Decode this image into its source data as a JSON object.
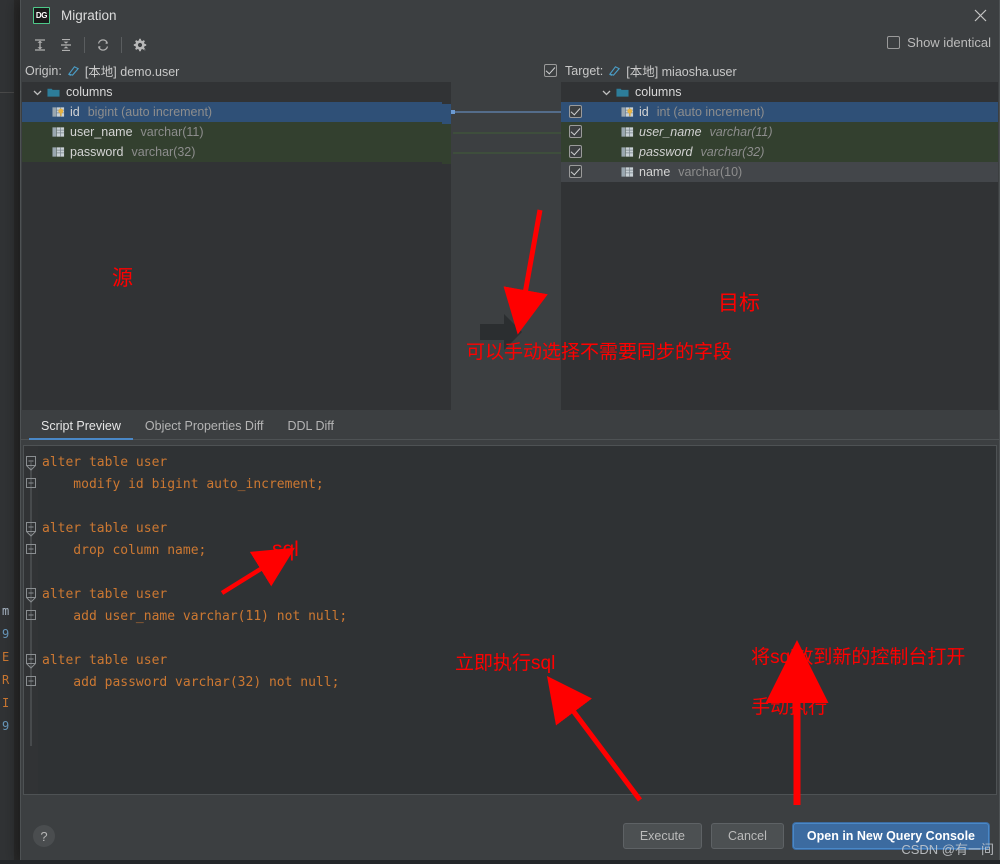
{
  "window": {
    "title": "Migration",
    "logo_text": "DG",
    "close_icon": "close-icon"
  },
  "toolbar": {
    "buttons": [
      {
        "name": "expand-all-icon",
        "tooltip": "Expand All"
      },
      {
        "name": "collapse-all-icon",
        "tooltip": "Collapse All"
      },
      {
        "name": "refresh-icon",
        "tooltip": "Refresh"
      },
      {
        "name": "settings-gear-icon",
        "tooltip": "Settings"
      }
    ],
    "show_identical_label": "Show identical",
    "show_identical_checked": false
  },
  "origin": {
    "label": "Origin:",
    "value": "[本地] demo.user",
    "checkbox_visible": false
  },
  "target": {
    "label": "Target:",
    "value": "[本地] miaosha.user",
    "checkbox_checked": true
  },
  "left_pane": {
    "root": {
      "label": "columns",
      "expanded": true
    },
    "rows": [
      {
        "name": "id",
        "type": "bigint (auto increment)",
        "state": "selected",
        "icon": "primary-key-column-icon",
        "italic": false
      },
      {
        "name": "user_name",
        "type": "varchar(11)",
        "state": "changed",
        "icon": "column-icon",
        "italic": false
      },
      {
        "name": "password",
        "type": "varchar(32)",
        "state": "changed",
        "icon": "column-icon",
        "italic": false
      }
    ]
  },
  "right_pane": {
    "root": {
      "label": "columns",
      "expanded": true
    },
    "rows": [
      {
        "name": "id",
        "type": "int (auto increment)",
        "state": "selected",
        "icon": "primary-key-column-icon",
        "italic": false,
        "checked": true
      },
      {
        "name": "user_name",
        "type": "varchar(11)",
        "state": "changed",
        "icon": "column-icon",
        "italic": true,
        "checked": true
      },
      {
        "name": "password",
        "type": "varchar(32)",
        "state": "changed",
        "icon": "column-icon",
        "italic": true,
        "checked": true
      },
      {
        "name": "name",
        "type": "varchar(10)",
        "state": "removed",
        "icon": "column-icon",
        "italic": false,
        "checked": true
      }
    ]
  },
  "tabs": [
    {
      "label": "Script Preview",
      "active": true
    },
    {
      "label": "Object Properties Diff",
      "active": false
    },
    {
      "label": "DDL Diff",
      "active": false
    }
  ],
  "script": {
    "statements": [
      {
        "head": "alter table user",
        "body": "    modify id bigint auto_increment;"
      },
      {
        "head": "alter table user",
        "body": "    drop column name;"
      },
      {
        "head": "alter table user",
        "body": "    add user_name varchar(11) not null;"
      },
      {
        "head": "alter table user",
        "body": "    add password varchar(32) not null;"
      }
    ]
  },
  "footer": {
    "help_label": "?",
    "execute_label": "Execute",
    "cancel_label": "Cancel",
    "open_console_label": "Open in New Query Console"
  },
  "annotations": [
    {
      "id": "source",
      "text": "源"
    },
    {
      "id": "target",
      "text": "目标"
    },
    {
      "id": "fields",
      "text": "可以手动选择不需要同步的字段"
    },
    {
      "id": "sql",
      "text": "sql"
    },
    {
      "id": "execute",
      "text": "立即执行sql"
    },
    {
      "id": "console_line1",
      "text": "将sql放到新的控制台打开"
    },
    {
      "id": "console_line2",
      "text": "手动执行"
    }
  ],
  "watermark": "CSDN @有一间",
  "background_code_tokens": [
    "m",
    "9",
    "E",
    "R",
    "I",
    "9"
  ],
  "colors": {
    "dialog_bg": "#3c3f41",
    "pane_bg": "#313335",
    "row_selected": "#2f5077",
    "row_changed": "#33402f",
    "row_removed": "#43464a",
    "accent_blue": "#4a88c7",
    "primary_button": "#3c6ba0",
    "annotation_red": "#ff0000",
    "keyword_orange": "#cc7832",
    "identifier_purple": "#9876aa",
    "number_blue": "#6897bb",
    "text_gray": "#a9b7c6",
    "logo_green": "#4ec98a"
  }
}
